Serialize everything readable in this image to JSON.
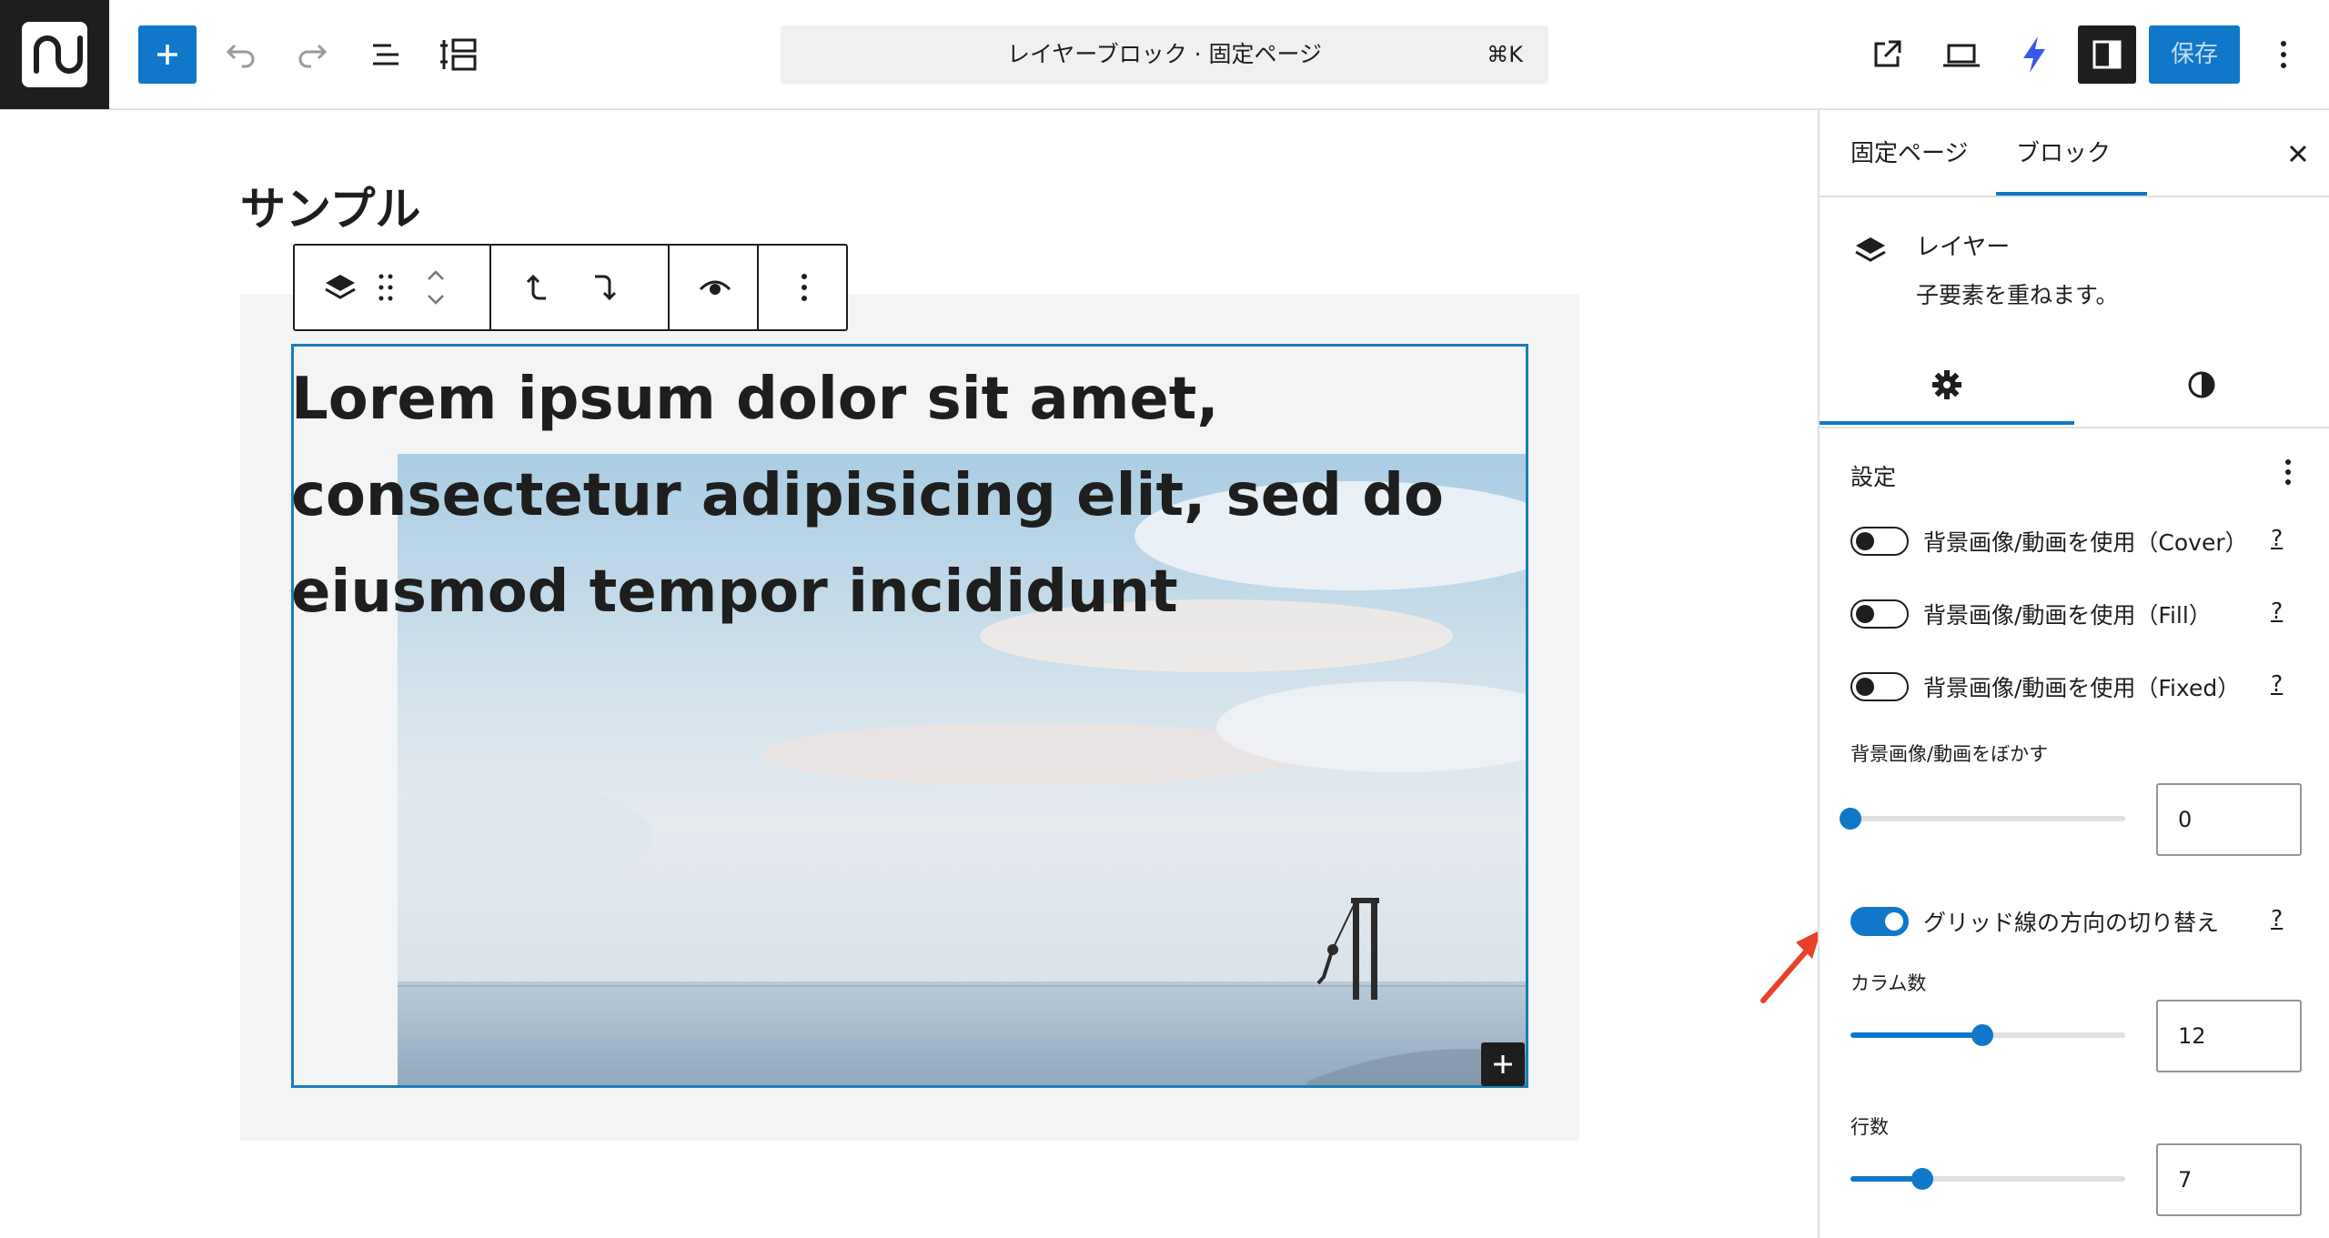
{
  "topbar": {
    "command_title": "レイヤーブロック · 固定ページ",
    "command_shortcut": "⌘K",
    "save_label": "保存",
    "icons": [
      "plus-icon",
      "undo-icon",
      "redo-icon",
      "list-view-icon",
      "document-outline-icon",
      "external-link-icon",
      "laptop-icon",
      "bolt-icon",
      "sidebar-icon",
      "more-vertical-icon"
    ]
  },
  "editor": {
    "page_title": "サンプル",
    "lorem_lines": [
      "Lorem ipsum dolor sit amet,",
      "consectetur adipisicing elit, sed do",
      "eiusmod tempor incididunt"
    ],
    "toolbar_icons": [
      "layers-icon",
      "drag-handle-icon",
      "move-up-down-icon",
      "arrow-up-left-icon",
      "arrow-down-right-icon",
      "eye-icon",
      "more-vertical-icon"
    ]
  },
  "sidebar": {
    "tabs": [
      "固定ページ",
      "ブロック"
    ],
    "active_tab": "ブロック",
    "block_card": {
      "title": "レイヤー",
      "description": "子要素を重ねます。"
    },
    "panel_title": "設定",
    "toggles": [
      {
        "label": "背景画像/動画を使用（Cover）",
        "help": "?",
        "on": false
      },
      {
        "label": "背景画像/動画を使用（Fill）",
        "help": "?",
        "on": false
      },
      {
        "label": "背景画像/動画を使用（Fixed）",
        "help": "?",
        "on": false
      }
    ],
    "blur": {
      "label": "背景画像/動画をぼかす",
      "value": "0",
      "fraction": 0.0
    },
    "grid_toggle": {
      "label": "グリッド線の方向の切り替え",
      "help": "?",
      "on": true
    },
    "columns": {
      "label": "カラム数",
      "value": "12",
      "fraction": 0.48
    },
    "rows": {
      "label": "行数",
      "value": "7",
      "fraction": 0.26
    }
  },
  "colors": {
    "accent": "#1078c9",
    "dark": "#1e1e1e",
    "arrow": "#e8402b"
  }
}
